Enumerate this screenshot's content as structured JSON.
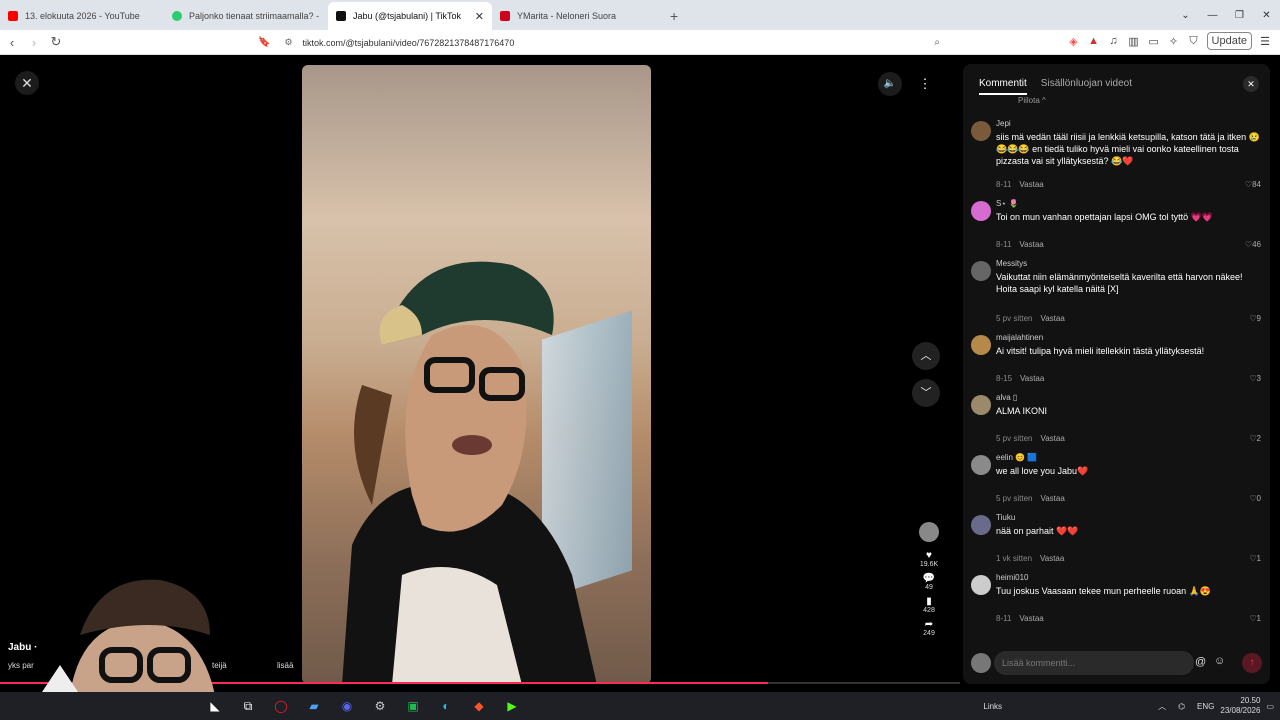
{
  "browser": {
    "tabs": [
      {
        "title": "13. elokuuta 2026 - YouTube",
        "color": "#ff0000",
        "active": false
      },
      {
        "title": "Paljonko tienaat striimaamalla? - La",
        "color": "#2ecc71",
        "active": false
      },
      {
        "title": "Jabu (@tsjabulani) | TikTok",
        "color": "#111111",
        "active": true
      },
      {
        "title": "YMarita - Neloneri Suora",
        "color": "#d0021b",
        "active": false
      }
    ],
    "new_tab": "+",
    "url": "tiktok.com/@tsjabulani/video/7672821378487176470",
    "update_label": "Update"
  },
  "video": {
    "caption_user": "Jabu ·",
    "caption_text": "yks par",
    "caption_mid": "teijä",
    "caption_more": "lisää",
    "progress": 0.8,
    "likes": "19.6K",
    "comments": "49",
    "saves": "428",
    "shares": "249"
  },
  "panel": {
    "tab_comments": "Kommentit",
    "tab_creator": "Sisällönluojan videot",
    "hide_label": "Piilota ^",
    "reply_label": "Vastaa",
    "input_placeholder": "Lisää kommentti...",
    "comments": [
      {
        "user": "Jepi",
        "text": "siis mä vedän tääl riisii ja lenkkiä ketsupilla, katson tätä ja itken 😢😂😂😂 en tiedä tuliko hyvä mieli vai oonko kateellinen tosta pizzasta vai sit yllätyksestä? 😂❤️",
        "time": "8-11",
        "likes": "84",
        "color": "#7a5a3a"
      },
      {
        "user": "S⋆ 🌷",
        "text": "Toi on mun vanhan opettajan lapsi OMG tol tyttö 💗💗",
        "time": "8-11",
        "likes": "46",
        "color": "#d66bd0"
      },
      {
        "user": "Messitys",
        "text": "Vaikuttat niin elämänmyönteiseltä kaverilta että harvon näkee! Hoita saapi kyl katella näitä [X]",
        "time": "5 pv sitten",
        "likes": "9",
        "color": "#666666"
      },
      {
        "user": "maijalahtinen",
        "text": "Ai vitsit! tulipa hyvä mieli itellekkin tästä yllätyksestä!",
        "time": "8-15",
        "likes": "3",
        "color": "#b5894a"
      },
      {
        "user": "alva ▯",
        "text": "ALMA IKONI",
        "time": "5 pv sitten",
        "likes": "2",
        "color": "#9a8a6a"
      },
      {
        "user": "eelin 😊 🟦",
        "text": "we all love you Jabu❤️",
        "time": "5 pv sitten",
        "likes": "0",
        "color": "#8a8a8a"
      },
      {
        "user": "Tiuku",
        "text": "nää on parhait ❤️❤️",
        "time": "1 vk sitten",
        "likes": "1",
        "color": "#6a6a8a"
      },
      {
        "user": "heimi010",
        "text": "Tuu joskus Vaasaan tekee mun perheelle ruoan 🙏😍",
        "time": "8-11",
        "likes": "1",
        "color": "#cccccc"
      }
    ]
  },
  "taskbar": {
    "links": "Links",
    "lang": "ENG",
    "time": "20.50",
    "date": "23/08/2026"
  }
}
